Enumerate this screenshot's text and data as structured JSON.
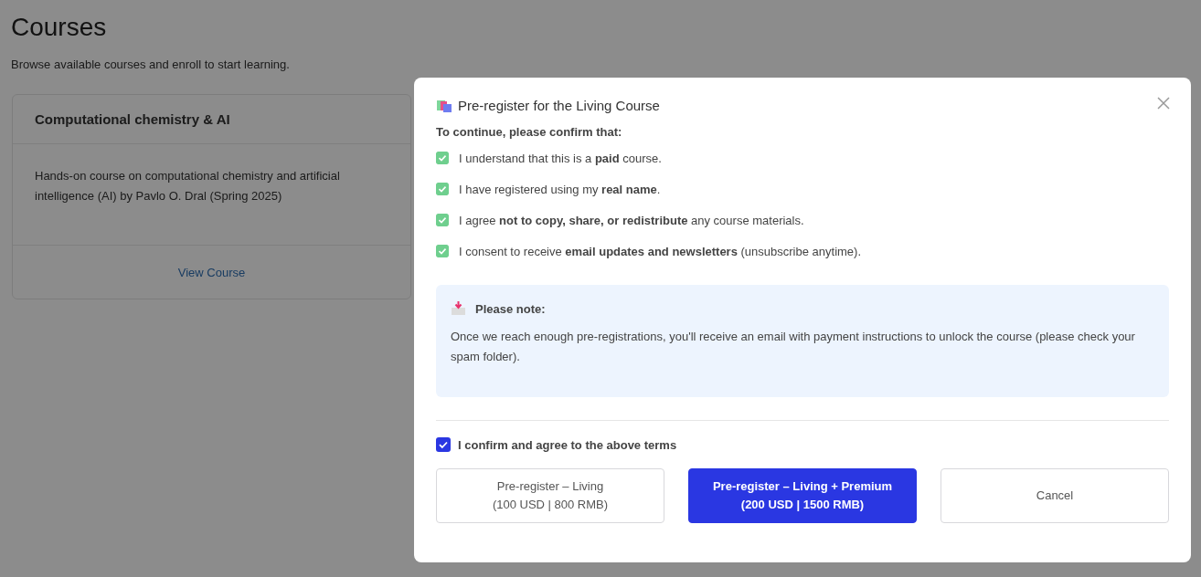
{
  "page": {
    "title": "Courses",
    "subtitle": "Browse available courses and enroll to start learning."
  },
  "courses": [
    {
      "title": "Computational chemistry & AI",
      "description": "Hands-on course on computational chemistry and artificial intelligence (AI) by Pavlo O. Dral (Spring 2025)",
      "link": "View Course"
    }
  ],
  "dialog": {
    "title": "Pre-register for the Living Course",
    "intro": "To continue, please confirm that:",
    "items": [
      {
        "text": "I understand that this is a **paid** course.",
        "checked": true
      },
      {
        "text": "I have registered using my **real name**.",
        "checked": true
      },
      {
        "text": "I agree **not to copy, share, or redistribute** any course materials.",
        "checked": true
      },
      {
        "text": "I consent to receive **email updates and newsletters** (unsubscribe anytime).",
        "checked": true
      }
    ],
    "note": {
      "title": "Please note:",
      "text": "Once we reach enough pre-registrations, you'll receive an email with payment instructions to unlock the course (please check your spam folder)."
    },
    "confirm": {
      "label": "I confirm and agree to the above terms",
      "checked": true
    },
    "buttons": [
      {
        "kind": "outline",
        "lines": [
          "Pre-register – Living",
          "(100 USD | 800 RMB)"
        ]
      },
      {
        "kind": "primary",
        "lines": [
          "Pre-register – Living + Premium",
          "(200 USD | 1500 RMB)"
        ]
      },
      {
        "kind": "outline",
        "lines": [
          "Cancel"
        ]
      }
    ]
  }
}
